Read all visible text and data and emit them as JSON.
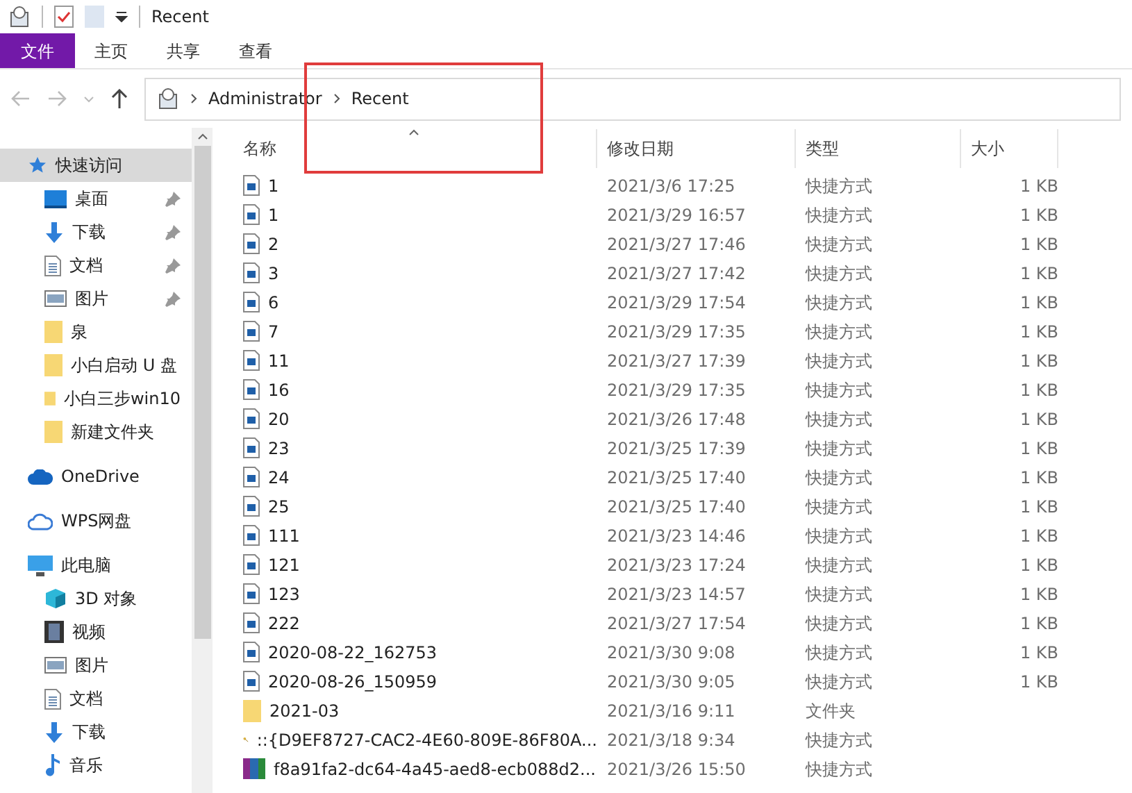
{
  "window": {
    "title": "Recent"
  },
  "ribbon_tabs": [
    {
      "label": "文件",
      "selected": true
    },
    {
      "label": "主页",
      "selected": false
    },
    {
      "label": "共享",
      "selected": false
    },
    {
      "label": "查看",
      "selected": false
    }
  ],
  "address_bar": {
    "path": [
      "Administrator",
      "Recent"
    ]
  },
  "sidebar": {
    "items": [
      {
        "label": "快速访问",
        "kind": "star",
        "selected": true,
        "pinned": false,
        "children": [
          {
            "label": "桌面",
            "kind": "desktop",
            "selected": false,
            "pinned": true
          },
          {
            "label": "下载",
            "kind": "download",
            "selected": false,
            "pinned": true
          },
          {
            "label": "文档",
            "kind": "document",
            "selected": false,
            "pinned": true
          },
          {
            "label": "图片",
            "kind": "picture",
            "selected": false,
            "pinned": true
          },
          {
            "label": "泉",
            "kind": "folder",
            "selected": false,
            "pinned": false
          },
          {
            "label": "小白启动 U 盘",
            "kind": "folder",
            "selected": false,
            "pinned": false
          },
          {
            "label": "小白三步win10",
            "kind": "folder",
            "selected": false,
            "pinned": false
          },
          {
            "label": "新建文件夹",
            "kind": "folder",
            "selected": false,
            "pinned": false
          }
        ]
      },
      {
        "label": "OneDrive",
        "kind": "cloud",
        "selected": false,
        "pinned": false
      },
      {
        "label": "WPS网盘",
        "kind": "cloud-outline",
        "selected": false,
        "pinned": false
      },
      {
        "label": "此电脑",
        "kind": "computer",
        "selected": false,
        "pinned": false,
        "children": [
          {
            "label": "3D 对象",
            "kind": "cube",
            "selected": false,
            "pinned": false
          },
          {
            "label": "视频",
            "kind": "video",
            "selected": false,
            "pinned": false
          },
          {
            "label": "图片",
            "kind": "picture",
            "selected": false,
            "pinned": false
          },
          {
            "label": "文档",
            "kind": "document",
            "selected": false,
            "pinned": false
          },
          {
            "label": "下载",
            "kind": "download",
            "selected": false,
            "pinned": false
          },
          {
            "label": "音乐",
            "kind": "music",
            "selected": false,
            "pinned": false
          }
        ]
      }
    ]
  },
  "table": {
    "columns": [
      "名称",
      "修改日期",
      "类型",
      "大小"
    ],
    "rows": [
      {
        "kind": "shortcut",
        "name": "1",
        "date": "2021/3/6 17:25",
        "type": "快捷方式",
        "size": "1 KB"
      },
      {
        "kind": "shortcut",
        "name": "1",
        "date": "2021/3/29 16:57",
        "type": "快捷方式",
        "size": "1 KB"
      },
      {
        "kind": "shortcut",
        "name": "2",
        "date": "2021/3/27 17:46",
        "type": "快捷方式",
        "size": "1 KB"
      },
      {
        "kind": "shortcut",
        "name": "3",
        "date": "2021/3/27 17:42",
        "type": "快捷方式",
        "size": "1 KB"
      },
      {
        "kind": "shortcut",
        "name": "6",
        "date": "2021/3/29 17:54",
        "type": "快捷方式",
        "size": "1 KB"
      },
      {
        "kind": "shortcut",
        "name": "7",
        "date": "2021/3/29 17:35",
        "type": "快捷方式",
        "size": "1 KB"
      },
      {
        "kind": "shortcut",
        "name": "11",
        "date": "2021/3/27 17:39",
        "type": "快捷方式",
        "size": "1 KB"
      },
      {
        "kind": "shortcut",
        "name": "16",
        "date": "2021/3/29 17:35",
        "type": "快捷方式",
        "size": "1 KB"
      },
      {
        "kind": "shortcut",
        "name": "20",
        "date": "2021/3/26 17:48",
        "type": "快捷方式",
        "size": "1 KB"
      },
      {
        "kind": "shortcut",
        "name": "23",
        "date": "2021/3/25 17:39",
        "type": "快捷方式",
        "size": "1 KB"
      },
      {
        "kind": "shortcut",
        "name": "24",
        "date": "2021/3/25 17:40",
        "type": "快捷方式",
        "size": "1 KB"
      },
      {
        "kind": "shortcut",
        "name": "25",
        "date": "2021/3/25 17:40",
        "type": "快捷方式",
        "size": "1 KB"
      },
      {
        "kind": "shortcut",
        "name": "111",
        "date": "2021/3/23 14:46",
        "type": "快捷方式",
        "size": "1 KB"
      },
      {
        "kind": "shortcut",
        "name": "121",
        "date": "2021/3/23 17:24",
        "type": "快捷方式",
        "size": "1 KB"
      },
      {
        "kind": "shortcut",
        "name": "123",
        "date": "2021/3/23 14:57",
        "type": "快捷方式",
        "size": "1 KB"
      },
      {
        "kind": "shortcut",
        "name": "222",
        "date": "2021/3/27 17:54",
        "type": "快捷方式",
        "size": "1 KB"
      },
      {
        "kind": "shortcut",
        "name": "2020-08-22_162753",
        "date": "2021/3/30 9:08",
        "type": "快捷方式",
        "size": "1 KB"
      },
      {
        "kind": "shortcut",
        "name": "2020-08-26_150959",
        "date": "2021/3/30 9:05",
        "type": "快捷方式",
        "size": "1 KB"
      },
      {
        "kind": "folder",
        "name": "2021-03",
        "date": "2021/3/16 9:11",
        "type": "文件夹"
      },
      {
        "kind": "keys",
        "name": "::{D9EF8727-CAC2-4E60-809E-86F80A...",
        "date": "2021/3/18 9:34",
        "type": "快捷方式"
      },
      {
        "kind": "archive",
        "name": "f8a91fa2-dc64-4a45-aed8-ecb088d2...",
        "date": "2021/3/26 15:50",
        "type": "快捷方式"
      }
    ]
  }
}
